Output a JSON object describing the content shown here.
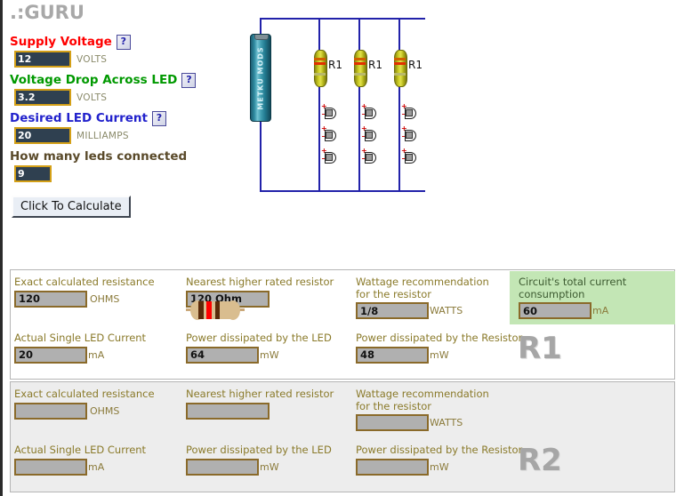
{
  "site": {
    "title": ".:GURU"
  },
  "form": {
    "fields": [
      {
        "label": "Supply Voltage",
        "color": "red",
        "help": "?",
        "value": "12",
        "unit": "VOLTS",
        "name": "supply-voltage"
      },
      {
        "label": "Voltage Drop Across LED",
        "color": "green",
        "help": "?",
        "value": "3.2",
        "unit": "VOLTS",
        "name": "voltage-drop-led"
      },
      {
        "label": "Desired LED Current",
        "color": "blue",
        "help": "?",
        "value": "20",
        "unit": "MILLIAMPS",
        "name": "desired-led-current"
      },
      {
        "label": "How many leds connected",
        "color": "brown",
        "help": "",
        "value": "9",
        "unit": "",
        "name": "leds-connected"
      }
    ],
    "calculate_button": "Click To Calculate"
  },
  "circuit": {
    "battery_brand": "METKU MODS",
    "resistor_labels": [
      "R1",
      "R1",
      "R1"
    ],
    "branches": 3,
    "leds_per_branch": 3
  },
  "results": {
    "r1": {
      "id": "R1",
      "exact_resistance_label": "Exact calculated resistance",
      "exact_resistance_value": "120",
      "exact_resistance_unit": "OHMS",
      "nearest_resistor_label": "Nearest higher rated resistor",
      "nearest_resistor_value": "120 Ohm",
      "wattage_label": "Wattage recommendation for the resistor",
      "wattage_value": "1/8",
      "wattage_unit": "WATTS",
      "total_current_label": "Circuit's total current consumption",
      "total_current_value": "60",
      "total_current_unit": "mA",
      "led_current_label": "Actual Single LED Current",
      "led_current_value": "20",
      "led_current_unit": "mA",
      "led_power_label": "Power dissipated by the LED",
      "led_power_value": "64",
      "led_power_unit": "mW",
      "resistor_power_label": "Power dissipated by the Resistor",
      "resistor_power_value": "48",
      "resistor_power_unit": "mW"
    },
    "r2": {
      "id": "R2",
      "exact_resistance_label": "Exact calculated resistance",
      "exact_resistance_value": "",
      "exact_resistance_unit": "OHMS",
      "nearest_resistor_label": "Nearest higher rated resistor",
      "nearest_resistor_value": "",
      "wattage_label": "Wattage recommendation for the resistor",
      "wattage_value": "",
      "wattage_unit": "WATTS",
      "led_current_label": "Actual Single LED Current",
      "led_current_value": "",
      "led_current_unit": "mA",
      "led_power_label": "Power dissipated by the LED",
      "led_power_value": "",
      "led_power_unit": "mW",
      "resistor_power_label": "Power dissipated by the Resistor",
      "resistor_power_value": "",
      "resistor_power_unit": "mW"
    }
  },
  "colors": {
    "input_bg": "#2f4050",
    "input_border": "#d4a017",
    "output_bg": "#b0b0b0",
    "output_border": "#8a6a2a",
    "highlight_green": "#c3e6b5",
    "wire": "#2222aa",
    "label_red": "#ff0000",
    "label_green": "#009900",
    "label_blue": "#2222cc"
  }
}
